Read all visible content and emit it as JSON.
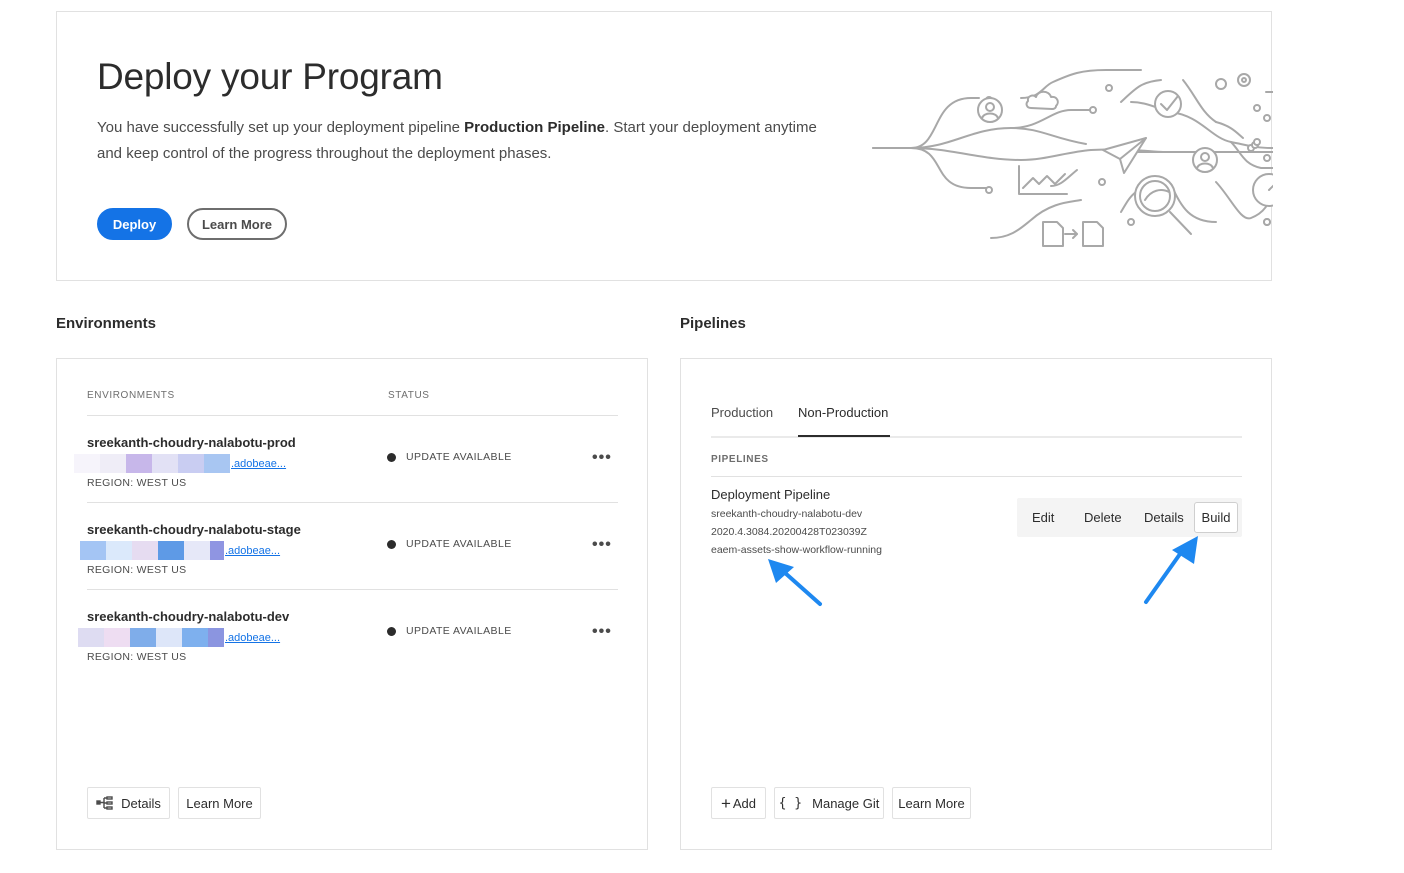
{
  "hero": {
    "title": "Deploy your Program",
    "desc_before": "You have successfully set up your deployment pipeline ",
    "desc_bold": "Production Pipeline",
    "desc_after": ". Start your deployment anytime and keep control of the progress throughout the deployment phases.",
    "deploy_label": "Deploy",
    "learn_more_label": "Learn More"
  },
  "environments": {
    "section_title": "Environments",
    "col_env": "ENVIRONMENTS",
    "col_status": "STATUS",
    "rows": [
      {
        "name": "sreekanth-choudry-nalabotu-prod",
        "link": ".adobeae...",
        "region": "REGION: WEST US",
        "status": "UPDATE AVAILABLE"
      },
      {
        "name": "sreekanth-choudry-nalabotu-stage",
        "link": ".adobeae...",
        "region": "REGION: WEST US",
        "status": "UPDATE AVAILABLE"
      },
      {
        "name": "sreekanth-choudry-nalabotu-dev",
        "link": ".adobeae...",
        "region": "REGION: WEST US",
        "status": "UPDATE AVAILABLE"
      }
    ],
    "more_label": "•••",
    "details_label": "Details",
    "learn_more_label": "Learn More"
  },
  "pipelines": {
    "section_title": "Pipelines",
    "tabs": [
      "Production",
      "Non-Production"
    ],
    "col_head": "PIPELINES",
    "pipeline": {
      "name": "Deployment Pipeline",
      "environment": "sreekanth-choudry-nalabotu-dev",
      "version": "2020.4.3084.20200428T023039Z",
      "branch": "eaem-assets-show-workflow-running"
    },
    "actions": {
      "edit": "Edit",
      "delete": "Delete",
      "details": "Details",
      "build": "Build"
    },
    "add_label": "Add",
    "add_icon": "+",
    "manage_git_label": "Manage Git",
    "git_icon": "{ }",
    "learn_more_label": "Learn More"
  },
  "colors": {
    "accent": "#1473e6",
    "annotation_arrow": "#1e88f0"
  }
}
